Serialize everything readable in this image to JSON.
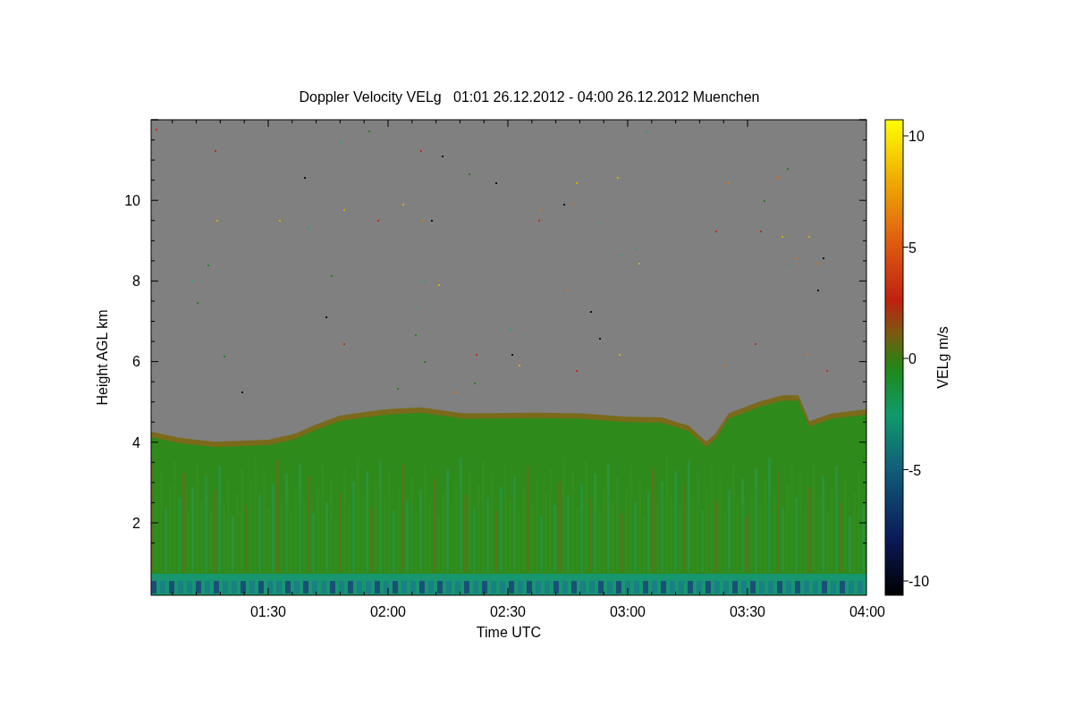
{
  "title": "Doppler Velocity VELg   01:01 26.12.2012 - 04:00 26.12.2012 Muenchen",
  "plot": {
    "xlabel": "Time UTC",
    "ylabel": "Height AGL km",
    "xticks": [
      "01:30",
      "02:00",
      "02:30",
      "03:00",
      "03:30",
      "04:00"
    ],
    "yticks": [
      "10",
      "8",
      "6",
      "4",
      "2"
    ]
  },
  "colorbar": {
    "label": "VELg m/s",
    "ticks": [
      "10",
      "5",
      "0",
      "-5",
      "-10"
    ]
  }
}
